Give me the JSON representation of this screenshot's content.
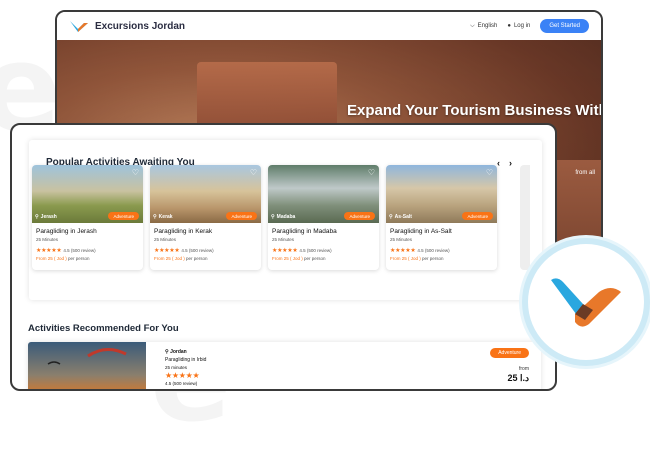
{
  "brand": {
    "name": "Excursions Jordan"
  },
  "nav": {
    "language": "English",
    "login": "Log in",
    "cta": "Get Started"
  },
  "hero": {
    "title": "Expand Your Tourism Business With",
    "subtitle": "from all"
  },
  "popular": {
    "title": "Popular Activities Awaiting You",
    "prev": "‹",
    "next": "›",
    "cards": [
      {
        "location": "Jerash",
        "badge": "Adventure",
        "title": "Paragliding in Jerash",
        "duration": "25 Minutes",
        "rating": "4.5 (500 review)",
        "stars": "★★★★★",
        "from": "From 25 ( Jod )",
        "per": "per person"
      },
      {
        "location": "Kerak",
        "badge": "Adventure",
        "title": "Paragliding in Kerak",
        "duration": "25 Minutes",
        "rating": "4.5 (500 review)",
        "stars": "★★★★★",
        "from": "From 25 ( Jod )",
        "per": "per person"
      },
      {
        "location": "Madaba",
        "badge": "Adventure",
        "title": "Paragliding in Madaba",
        "duration": "25 Minutes",
        "rating": "4.5 (500 review)",
        "stars": "★★★★★",
        "from": "From 25 ( Jod )",
        "per": "per person"
      },
      {
        "location": "As-Salt",
        "badge": "Adventure",
        "title": "Paragliding in As-Salt",
        "duration": "25 Minutes",
        "rating": "4.5 (500 review)",
        "stars": "★★★★★",
        "from": "From 25 ( Jod )",
        "per": "per person"
      }
    ]
  },
  "recommended": {
    "title": "Activities Recommended For You",
    "city": "Jordan",
    "activity": "Paragliding in Irbid",
    "duration": "25 minutes",
    "stars": "★★★★★",
    "rating": "4.5 (500 review)",
    "badge": "Adventure",
    "from": "from",
    "price": "25 د.ا"
  },
  "colors": {
    "accent": "#f97316",
    "primary": "#3b82f6",
    "logo_blue": "#2aa7df",
    "logo_orange": "#e8782a"
  },
  "icons": [
    "chevron-down-icon",
    "user-icon",
    "heart-icon",
    "location-pin-icon",
    "star-icon",
    "chevron-left-icon",
    "chevron-right-icon"
  ]
}
